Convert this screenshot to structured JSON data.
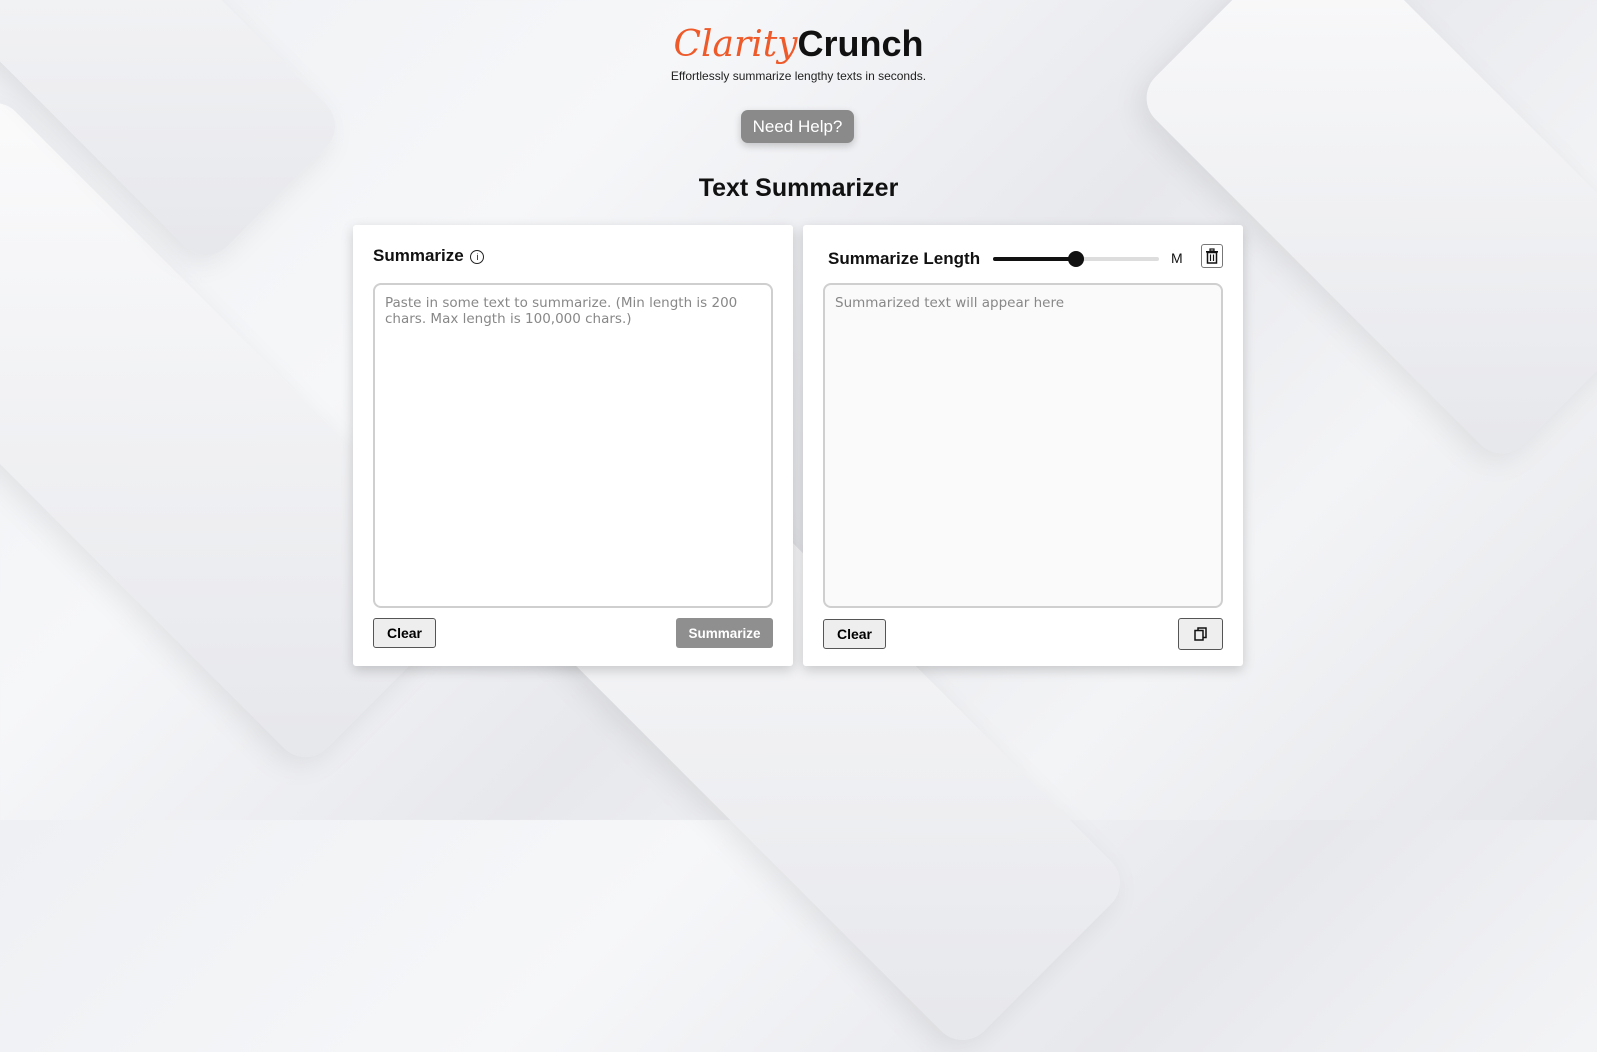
{
  "brand": {
    "name_part1": "Clarity",
    "name_part2": "Crunch",
    "tagline": "Effortlessly summarize lengthy texts in seconds."
  },
  "help_button": "Need Help?",
  "page_title": "Text Summarizer",
  "input_panel": {
    "title": "Summarize",
    "placeholder": "Paste in some text to summarize. (Min length is 200 chars. Max length is 100,000 chars.)",
    "clear_label": "Clear",
    "summarize_label": "Summarize"
  },
  "output_panel": {
    "title": "Summarize Length",
    "length_value": "M",
    "slider_level": 0.5,
    "placeholder": "Summarized text will appear here",
    "clear_label": "Clear"
  },
  "icons": {
    "info": "info-icon",
    "trash": "trash-icon",
    "copy": "copy-icon"
  },
  "colors": {
    "brand_accent": "#ee5a2a",
    "button_gray": "#8a8a8a"
  }
}
